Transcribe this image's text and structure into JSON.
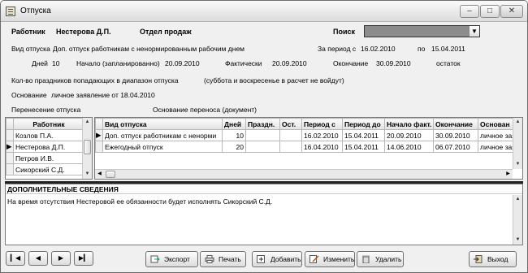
{
  "window": {
    "title": "Отпуска"
  },
  "header": {
    "employee_label": "Работник",
    "employee_value": "Нестерова Д.П.",
    "department": "Отдел продаж",
    "search_label": "Поиск"
  },
  "details": {
    "vacation_type_label": "Вид отпуска",
    "vacation_type_value": "Доп. отпуск работникам с ненормированным рабочим днем",
    "period_label": "За период с",
    "period_from": "16.02.2010",
    "period_to_label": "по",
    "period_to": "15.04.2011",
    "days_label": "Дней",
    "days_value": "10",
    "start_planned_label": "Начало (запланированно)",
    "start_planned_value": "20.09.2010",
    "actual_label": "Фактически",
    "actual_value": "20.09.2010",
    "end_label": "Окончание",
    "end_value": "30.09.2010",
    "remainder_label": "остаток",
    "holidays_label": "Кол-во праздников попадающих в диапазон отпуска",
    "holidays_note": "(суббота и воскресенье в расчет не войдут)",
    "basis_label": "Основание",
    "basis_value": "личное заявление от 18.04.2010",
    "transfer_label": "Перенесение отпуска",
    "transfer_basis_label": "Основание переноса (документ)"
  },
  "employees": {
    "header": "Работник",
    "rows": [
      "Козлов П.А.",
      "Нестерова Д.П.",
      "Петров И.В.",
      "Сикорский С.Д."
    ],
    "selected_index": 1
  },
  "vacations": {
    "columns": [
      "Вид отпуска",
      "Дней",
      "Праздн.",
      "Ост.",
      "Период с",
      "Период до",
      "Начало факт.",
      "Окончание",
      "Основан"
    ],
    "rows": [
      [
        "Доп. отпуск работникам с ненорми",
        "10",
        "",
        "",
        "16.02.2010",
        "15.04.2011",
        "20.09.2010",
        "30.09.2010",
        "личное зая"
      ],
      [
        "Ежегодный отпуск",
        "20",
        "",
        "",
        "16.04.2010",
        "15.04.2011",
        "14.06.2010",
        "06.07.2010",
        "личное зая"
      ]
    ],
    "selected_index": 0
  },
  "additional": {
    "header": "ДОПОЛНИТЕЛЬНЫЕ СВЕДЕНИЯ",
    "text": "На время отсутствия Нестеровой ее обязанности будет исполнять Сикорский С.Д."
  },
  "toolbar": {
    "export": "Экспорт",
    "print": "Печать",
    "add": "Добавить",
    "edit": "Изменить",
    "delete": "Удалить",
    "exit": "Выход"
  },
  "icons": {
    "nav_first": "first-record-icon",
    "nav_prev": "prev-record-icon",
    "nav_next": "next-record-icon",
    "nav_last": "last-record-icon"
  }
}
